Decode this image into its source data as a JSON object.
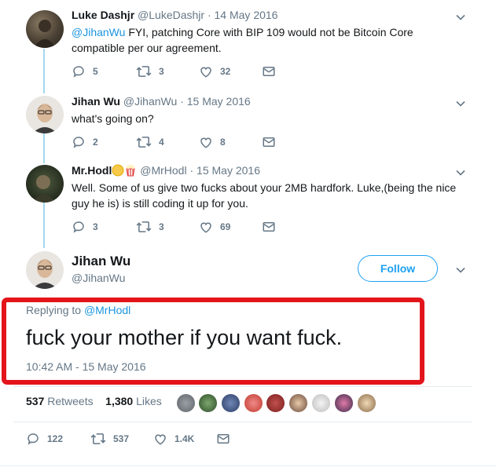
{
  "thread": [
    {
      "name": "Luke Dashjr",
      "handle": "@LukeDashjr",
      "date": "14 May 2016",
      "mention": "@JihanWu",
      "text_line1": " FYI, patching Core with BIP 109 would not be Bitcoin Core",
      "text_line2": "compatible per our agreement.",
      "replies": "5",
      "retweets": "3",
      "likes": "32"
    },
    {
      "name": "Jihan Wu",
      "handle": "@JihanWu",
      "date": "15 May 2016",
      "text_line1": "what's going on?",
      "replies": "2",
      "retweets": "4",
      "likes": "8"
    },
    {
      "name": "Mr.Hodl",
      "handle": "@MrHodl",
      "date": "15 May 2016",
      "text_line1": "Well. Some of us give two fucks about your 2MB hardfork. Luke,(being the nice",
      "text_line2": "guy he is) is still coding it up for you.",
      "replies": "3",
      "retweets": "3",
      "likes": "69"
    }
  ],
  "main_tweet": {
    "name": "Jihan Wu",
    "handle": "@JihanWu",
    "follow_label": "Follow",
    "replying_prefix": "Replying to ",
    "replying_to": "@MrHodl",
    "text": "fuck your mother if you want fuck.",
    "timestamp": "10:42 AM - 15 May 2016",
    "retweet_count": "537",
    "retweets_label": "Retweets",
    "like_count": "1,380",
    "likes_label": "Likes",
    "replies": "122",
    "retweets": "537",
    "likes": "1.4K"
  },
  "colors": {
    "accent": "#1da1f2",
    "mention": "#1b95e0",
    "highlight_border": "#e3151b",
    "muted": "#657786",
    "thread_line": "#a4d8f0"
  },
  "icons": [
    "reply-icon",
    "retweet-icon",
    "like-icon",
    "direct-message-icon",
    "chevron-down-icon"
  ]
}
